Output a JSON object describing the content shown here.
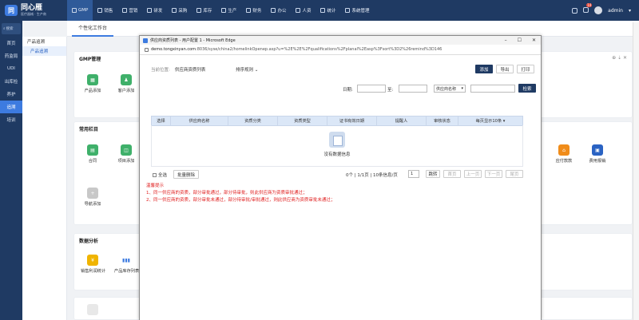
{
  "brand": {
    "name": "同心雁",
    "subtitle": "医疗器械 · 生产商",
    "logo": "同"
  },
  "nav": [
    {
      "label": "GMP",
      "icon": "home-icon",
      "active": true
    },
    {
      "label": "销售",
      "icon": "sales-icon"
    },
    {
      "label": "营销",
      "icon": "marketing-icon"
    },
    {
      "label": "研发",
      "icon": "rd-icon"
    },
    {
      "label": "采购",
      "icon": "cart-icon"
    },
    {
      "label": "库存",
      "icon": "warehouse-icon"
    },
    {
      "label": "生产",
      "icon": "factory-icon"
    },
    {
      "label": "财务",
      "icon": "finance-icon"
    },
    {
      "label": "办公",
      "icon": "office-icon"
    },
    {
      "label": "人资",
      "icon": "people-icon"
    },
    {
      "label": "统计",
      "icon": "stats-icon"
    },
    {
      "label": "系统管理",
      "icon": "settings-icon"
    }
  ],
  "topright": {
    "badge": "14",
    "user": "admin"
  },
  "sidebar": {
    "search_placeholder": "搜索",
    "items": [
      "首页",
      "药监局",
      "UDI",
      "出库检",
      "养护",
      "追溯",
      "培训"
    ],
    "active_index": 5
  },
  "subnav": {
    "head": "产品追溯",
    "item": "产品追溯"
  },
  "tabs": {
    "workbench": "个性化工作台"
  },
  "gmp": {
    "title": "GMP管理",
    "tiles": [
      {
        "label": "产品添加"
      },
      {
        "label": "客户添加"
      }
    ]
  },
  "common": {
    "title": "常用栏目",
    "tiles": [
      {
        "label": "合同"
      },
      {
        "label": "项目添加"
      },
      {
        "label": "导航添加"
      }
    ],
    "right_tiles": [
      {
        "label": "应付款款"
      },
      {
        "label": "费用报销"
      }
    ]
  },
  "analysis": {
    "title": "数据分析",
    "tiles": [
      {
        "label": "销售利润统计"
      },
      {
        "label": "产品库存列表"
      }
    ]
  },
  "window": {
    "title": "供应商资质列表 - 用户配置 1 - Microsoft Edge",
    "url_host": "demo.tongxinyan.com",
    "url_rest": ":8036/syse/china2/homelinkOpenep.asp?u=%2E%2E%2Fqualifications%2Fplanal%2Easp%3Fsort%3D2%26remind%3D146",
    "location_label": "当前位置:",
    "location_value": "供应商资质列表",
    "sort_label": "排序规则",
    "buttons": {
      "add": "添加",
      "export": "导出",
      "print": "打印",
      "search": "检索"
    },
    "filter": {
      "date_label": "日期:",
      "to_label": "至:",
      "field_select": "供应商名称"
    },
    "columns": [
      "选择",
      "供应商名称",
      "资质分类",
      "资质类型",
      "证书有效日期",
      "提醒人",
      "审核状态",
      "每页显示10条"
    ],
    "empty_text": "没有数据信息",
    "select_all": "全选",
    "batch_delete": "批量删除",
    "pager": {
      "summary": "0个 | 1/1页 | 10条信息/页",
      "page": "1",
      "jump": "跳转",
      "first": "首页",
      "prev": "上一页",
      "next": "下一页",
      "last": "尾页"
    },
    "notes": [
      "温馨提示",
      "1、同一供应商的资质，部分审批通过，部分待审批，则此供应商为资质审批通过；",
      "2、同一供应商的资质，部分审批未通过，部分待审批/审批通过，则此供应商为资质审批未通过；"
    ]
  },
  "colors": {
    "nav_bg": "#1f3a63",
    "accent": "#3d7be0",
    "warning": "#e02020"
  }
}
